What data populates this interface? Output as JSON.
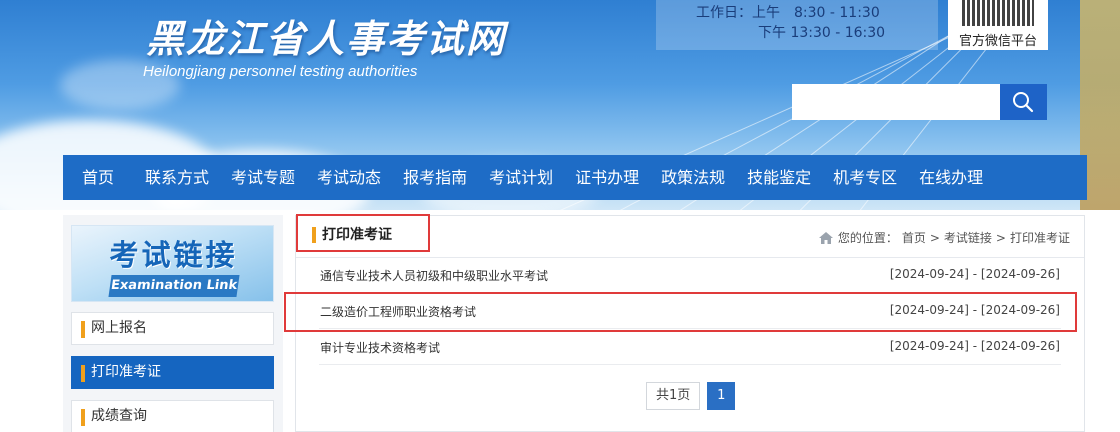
{
  "header": {
    "site_title": "黑龙江省人事考试网",
    "site_subtitle": "Heilongjiang personnel testing authorities",
    "worktime_label": "工作日：上午　8:30 - 11:30",
    "worktime_afternoon": "下午 13:30 - 16:30",
    "qr_label": "官方微信平台",
    "search": {
      "value": "",
      "placeholder": ""
    }
  },
  "nav": {
    "items": [
      "首页",
      "联系方式",
      "考试专题",
      "考试动态",
      "报考指南",
      "考试计划",
      "证书办理",
      "政策法规",
      "技能鉴定",
      "机考专区",
      "在线办理"
    ]
  },
  "sidebar": {
    "banner_title": "考试链接",
    "banner_en": "Examination Link",
    "items": [
      {
        "label": "网上报名",
        "active": false
      },
      {
        "label": "打印准考证",
        "active": true
      },
      {
        "label": "成绩查询",
        "active": false
      }
    ]
  },
  "main": {
    "section_title": "打印准考证",
    "location_prefix": "您的位置：",
    "breadcrumb": [
      "首页",
      "考试链接",
      "打印准考证"
    ],
    "breadcrumb_sep": ">",
    "exams": [
      {
        "name": "通信专业技术人员初级和中级职业水平考试",
        "date": "[2024-09-24] - [2024-09-26]"
      },
      {
        "name": "二级造价工程师职业资格考试",
        "date": "[2024-09-24] - [2024-09-26]"
      },
      {
        "name": "审计专业技术资格考试",
        "date": "[2024-09-24] - [2024-09-26]"
      }
    ],
    "pager": {
      "total": "共1页",
      "current": "1"
    }
  },
  "colors": {
    "nav_bg": "#1e6cc6",
    "accent_orange": "#f0a01c",
    "highlight_red": "#e03a3a",
    "active_blue": "#1565c0"
  },
  "icons": {
    "search": "search-icon",
    "home": "home-icon"
  }
}
